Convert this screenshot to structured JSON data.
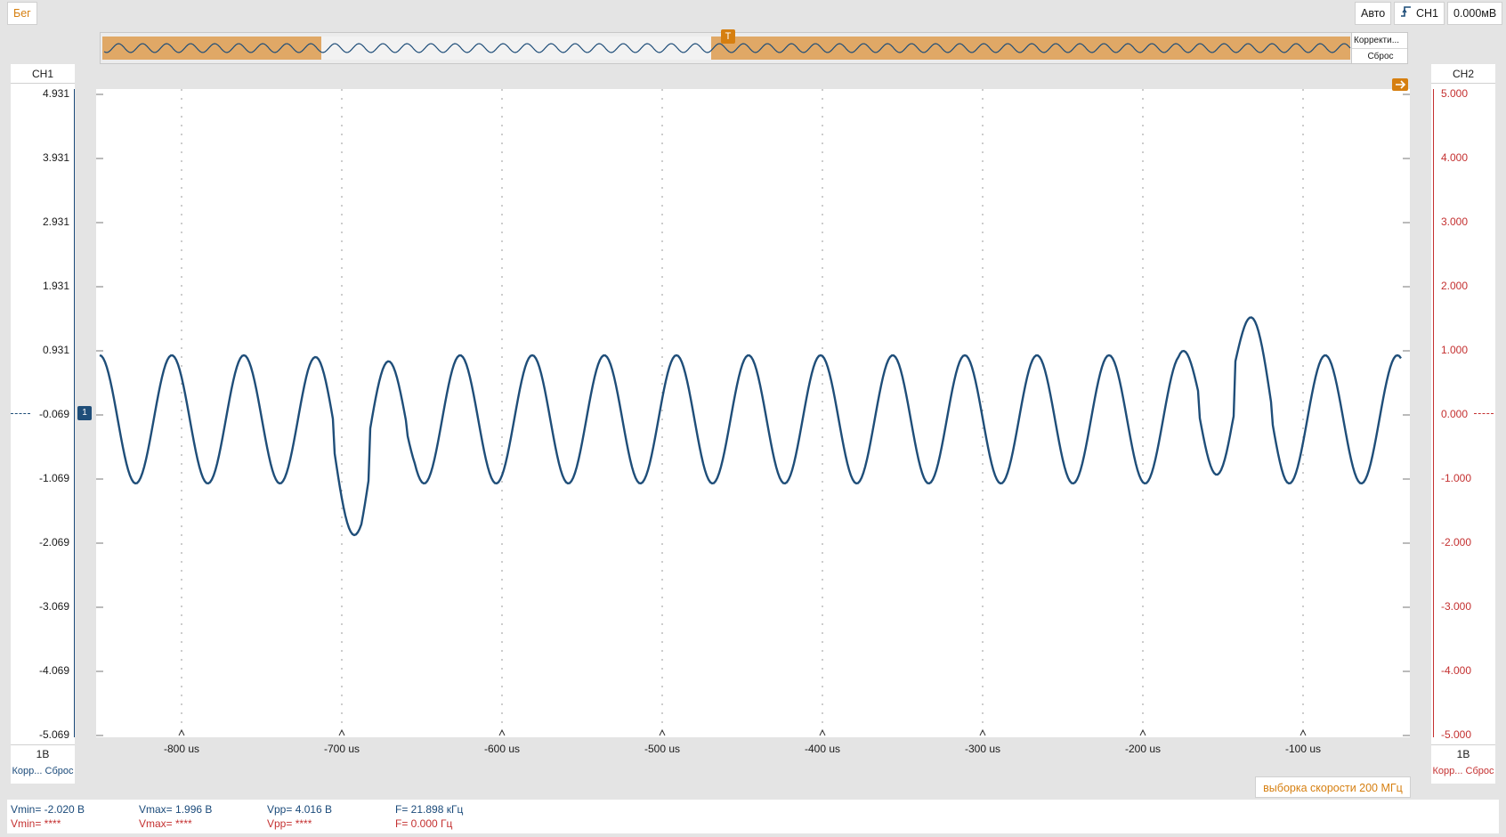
{
  "toolbar": {
    "run_label": "Бег",
    "mode_label": "Авто",
    "trigger_source": "CH1",
    "trigger_level": "0.000мВ"
  },
  "overview": {
    "correction_label": "Корректи...",
    "reset_label": "Сброс",
    "trigger_marker": "T"
  },
  "ch1": {
    "title": "CH1",
    "scale": "1В",
    "reset": "Корр... Сброс",
    "marker": "1",
    "y_labels": [
      "4.931",
      "3.931",
      "2.931",
      "1.931",
      "0.931",
      "-0.069",
      "-1.069",
      "-2.069",
      "-3.069",
      "-4.069",
      "-5.069"
    ],
    "color": "#1a4a7a"
  },
  "ch2": {
    "title": "CH2",
    "scale": "1В",
    "reset": "Корр... Сброс",
    "y_labels": [
      "5.000",
      "4.000",
      "3.000",
      "2.000",
      "1.000",
      "0.000",
      "-1.000",
      "-2.000",
      "-3.000",
      "-4.000",
      "-5.000"
    ],
    "color": "#c43030"
  },
  "x_axis": {
    "labels": [
      "-800 us",
      "-700 us",
      "-600 us",
      "-500 us",
      "-400 us",
      "-300 us",
      "-200 us",
      "-100 us"
    ]
  },
  "sample_rate": "выборка скорости 200 МГц",
  "measurements": {
    "ch1": {
      "vmin": "Vmin= -2.020 В",
      "vmax": "Vmax= 1.996 В",
      "vpp": "Vpp= 4.016 В",
      "f": "F= 21.898 кГц"
    },
    "ch2": {
      "vmin": "Vmin= ****",
      "vmax": "Vmax= ****",
      "vpp": "Vpp= ****",
      "f": "F= 0.000 Гц"
    }
  },
  "accent_color": "#d67f10",
  "trace_color": "#1f4e79"
}
